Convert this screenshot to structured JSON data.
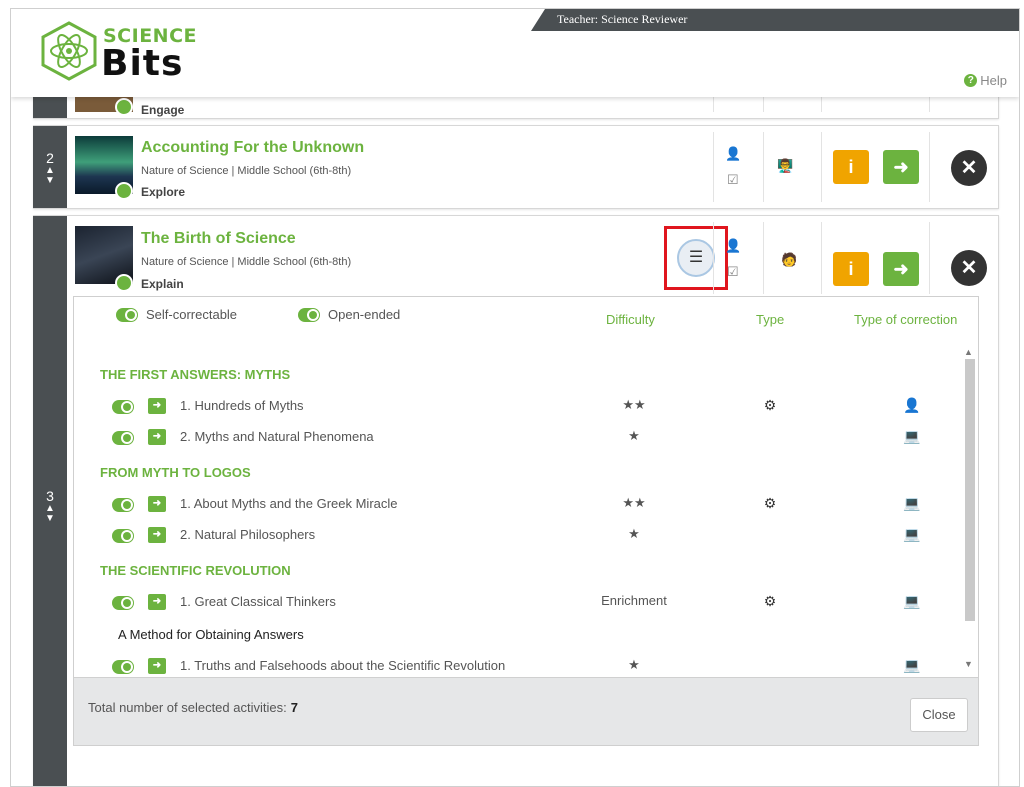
{
  "header": {
    "teacher_label": "Teacher: Science Reviewer",
    "logo_top": "SCIENCE",
    "logo_bottom": "Bits",
    "help": "Help"
  },
  "rows": [
    {
      "phase": "Engage"
    },
    {
      "num": "2",
      "title": "Accounting For the Unknown",
      "subtitle": "Nature of Science | Middle School (6th-8th)",
      "phase": "Explore"
    },
    {
      "num": "3",
      "title": "The Birth of Science",
      "subtitle": "Nature of Science | Middle School (6th-8th)",
      "phase": "Explain"
    }
  ],
  "panel": {
    "legend_self": "Self-correctable",
    "legend_open": "Open-ended",
    "col_difficulty": "Difficulty",
    "col_type": "Type",
    "col_correction": "Type of correction",
    "sections": [
      {
        "title": "THE FIRST ANSWERS: MYTHS"
      },
      {
        "title": "FROM MYTH TO LOGOS"
      },
      {
        "title": "THE SCIENTIFIC REVOLUTION"
      }
    ],
    "subsection": "A Method for Obtaining Answers",
    "items": [
      {
        "label": "1. Hundreds of Myths",
        "difficulty": "★★",
        "type": "⚙",
        "correction": "👤"
      },
      {
        "label": "2. Myths and Natural Phenomena",
        "difficulty": "★",
        "type": "",
        "correction": "💻"
      },
      {
        "label": "1. About Myths and the Greek Miracle",
        "difficulty": "★★",
        "type": "⚙",
        "correction": "💻"
      },
      {
        "label": "2. Natural Philosophers",
        "difficulty": "★",
        "type": "",
        "correction": "💻"
      },
      {
        "label": "1. Great Classical Thinkers",
        "difficulty": "Enrichment",
        "type": "⚙",
        "correction": "💻"
      },
      {
        "label": "1. Truths and Falsehoods about the Scientific Revolution",
        "difficulty": "★",
        "type": "",
        "correction": "💻"
      }
    ],
    "total_label": "Total number of selected activities:",
    "total_value": "7",
    "close": "Close"
  },
  "colors": {
    "green": "#6cb33f",
    "orange": "#f0a400",
    "dark": "#4a4f52",
    "highlight": "#e0161e"
  }
}
